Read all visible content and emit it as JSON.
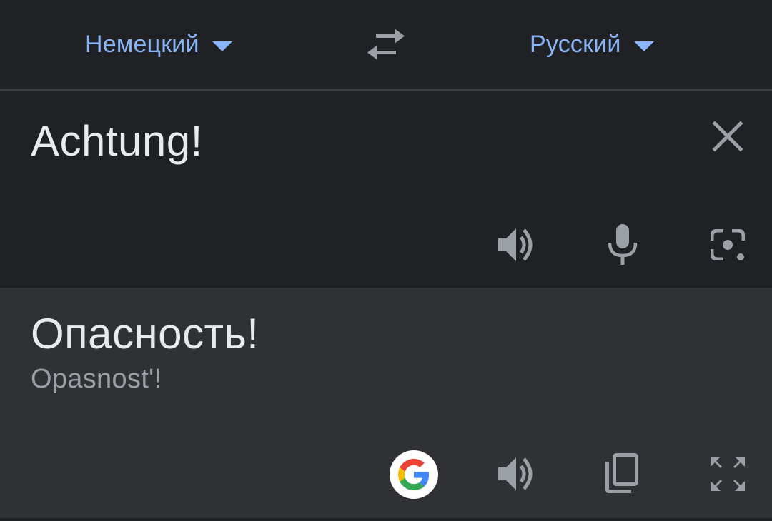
{
  "languages": {
    "source": "Немецкий",
    "target": "Русский"
  },
  "input": {
    "text": "Achtung!"
  },
  "output": {
    "translation": "Опасность!",
    "transliteration": "Opasnost'!"
  },
  "icons": {
    "swap": "swap-arrows-icon",
    "clear": "close-icon",
    "input_actions": [
      "speaker-icon",
      "microphone-icon",
      "camera-icon"
    ],
    "output_actions": [
      "google-logo-icon",
      "speaker-icon",
      "copy-icon",
      "fullscreen-icon"
    ]
  },
  "colors": {
    "accent": "#8ab4f8",
    "background": "#202124",
    "output_background": "#303134",
    "text_primary": "#e8eaed",
    "text_secondary": "#9aa0a6",
    "icon": "#9aa0a6"
  }
}
